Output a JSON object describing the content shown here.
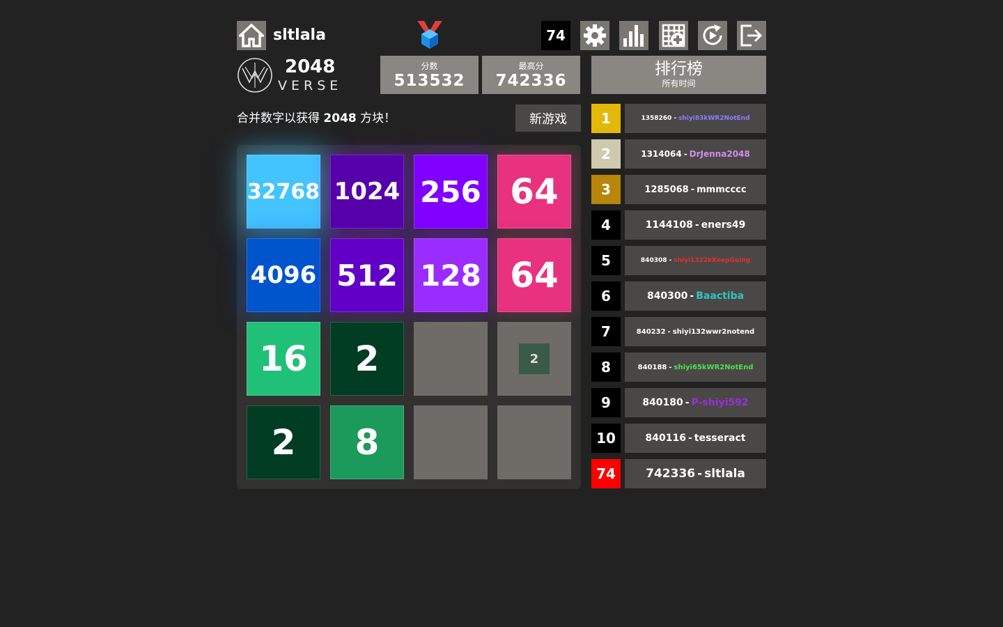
{
  "header": {
    "username": "sltlala",
    "rank": "74",
    "icons": [
      "home-icon",
      "medal-icon",
      "gear-icon",
      "stats-icon",
      "add-grid-icon",
      "replay-icon",
      "logout-icon"
    ]
  },
  "logo": {
    "title": "2048",
    "subtitle": "VERSE"
  },
  "score": {
    "label": "分数",
    "value": "513532"
  },
  "best": {
    "label": "最高分",
    "value": "742336"
  },
  "leaderboard": {
    "title": "排行榜",
    "subtitle": "所有时间",
    "entries": [
      {
        "rank": "1",
        "score": "1358260",
        "name": "shiyi83kWR2NotEnd",
        "rank_color": "#e4b80a",
        "name_color": "#8a7dff"
      },
      {
        "rank": "2",
        "score": "1314064",
        "name": "DrJenna2048",
        "rank_color": "#cfc9b0",
        "name_color": "#d58ce8"
      },
      {
        "rank": "3",
        "score": "1285068",
        "name": "mmmcccc",
        "rank_color": "#b8860b",
        "name_color": "#ffffff"
      },
      {
        "rank": "4",
        "score": "1144108",
        "name": "eners49",
        "rank_color": "#000000",
        "name_color": "#ffffff"
      },
      {
        "rank": "5",
        "score": "840308",
        "name": "shiyi1322kKeepGoing",
        "rank_color": "#000000",
        "name_color": "#e03030"
      },
      {
        "rank": "6",
        "score": "840300",
        "name": "Baactiba",
        "rank_color": "#000000",
        "name_color": "#2ec4c4"
      },
      {
        "rank": "7",
        "score": "840232",
        "name": "shiyi132wwr2notend",
        "rank_color": "#000000",
        "name_color": "#ffffff"
      },
      {
        "rank": "8",
        "score": "840188",
        "name": "shiyi65kWR2NotEnd",
        "rank_color": "#000000",
        "name_color": "#4ee04e"
      },
      {
        "rank": "9",
        "score": "840180",
        "name": "P-shiyi592",
        "rank_color": "#000000",
        "name_color": "#9a2fd8"
      },
      {
        "rank": "10",
        "score": "840116",
        "name": "tesseract",
        "rank_color": "#000000",
        "name_color": "#ffffff"
      },
      {
        "rank": "74",
        "score": "742336",
        "name": "sltlala",
        "rank_color": "#ff0000",
        "name_color": "#ffffff"
      }
    ]
  },
  "game": {
    "instructions_prefix": "合并数字以获得",
    "instructions_target": "2048",
    "instructions_suffix": "方块！",
    "new_game_label": "新游戏",
    "board": [
      [
        "32768",
        "1024",
        "256",
        "64"
      ],
      [
        "4096",
        "512",
        "128",
        "64"
      ],
      [
        "16",
        "2",
        "",
        "2"
      ],
      [
        "2",
        "8",
        "",
        ""
      ]
    ],
    "tile_colors": {
      "32768": "#44c4ff",
      "1024": "#5500aa",
      "256": "#8000ff",
      "64": "#e8317f",
      "4096": "#0055cc",
      "512": "#6200c6",
      "128": "#9b2cff",
      "16": "#21c079",
      "2": "#013d22",
      "8": "#1c9a5c",
      "spawn": "#3a5a48"
    }
  }
}
